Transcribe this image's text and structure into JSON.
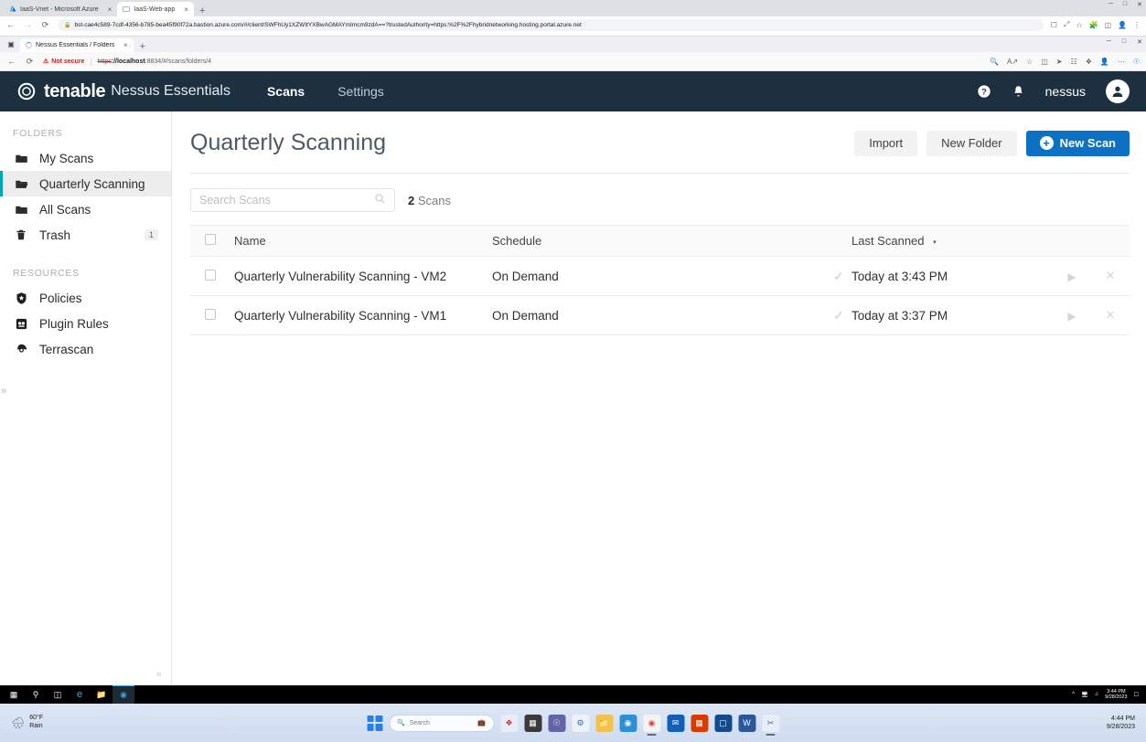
{
  "outer_browser": {
    "tabs": [
      {
        "title": "IaaS-Vnet - Microsoft Azure",
        "favicon": "azure-icon",
        "active": false
      },
      {
        "title": "IaaS-Web-app",
        "favicon": "page-icon",
        "active": true
      }
    ],
    "new_tab_label": "+",
    "close_label": "×",
    "window_controls": {
      "minimize": "─",
      "maximize": "□",
      "close": "✕"
    },
    "nav": {
      "back": "←",
      "forward": "→",
      "reload": "⟳"
    },
    "address": "bst-cae4c589-7cdf-4356-b785-bea45f90f72a.bastion.azure.com/#/client/SWFhUy1XZWItYXBwAGMAYmImcm9zdA==?trustedAuthority=https:%2F%2Fhybridnetworking.hosting.portal.azure.net",
    "lock_icon": "lock-icon",
    "toolbar_icons": [
      "cast-icon",
      "share-icon",
      "bookmark-star-icon",
      "extensions-puzzle-icon",
      "sidepanel-icon",
      "profile-avatar-icon",
      "more-kebab-icon"
    ]
  },
  "inner_browser": {
    "system_icon": "app-window-icon",
    "tab": {
      "title": "Nessus Essentials / Folders / Cus",
      "loading": true,
      "close_label": "×"
    },
    "new_tab_label": "+",
    "window_controls": {
      "minimize": "─",
      "maximize": "□",
      "close": "✕"
    },
    "nav": {
      "back": "←",
      "reload": "⟳"
    },
    "security_label": "Not secure",
    "url_scheme": "https",
    "url_host": "://localhost",
    "url_path": ":8834/#/scans/folders/4",
    "toolbar_icons": [
      "zoom-icon",
      "read-aloud-icon",
      "favorite-star-icon",
      "split-screen-icon",
      "collections-icon",
      "browser-essentials-icon",
      "copilot-icon",
      "profile-icon",
      "settings-more-icon",
      "bing-icon"
    ]
  },
  "app": {
    "brand": {
      "logo": "tenable-logo-icon",
      "name": "tenable",
      "product": "Nessus Essentials"
    },
    "nav_links": [
      {
        "label": "Scans",
        "active": true
      },
      {
        "label": "Settings",
        "active": false
      }
    ],
    "nav_right": {
      "help_icon": "help-question-icon",
      "notifications_icon": "bell-icon",
      "username": "nessus",
      "avatar_icon": "user-avatar-icon"
    },
    "sidebar": {
      "folders_heading": "FOLDERS",
      "folders": [
        {
          "label": "My Scans",
          "icon": "folder-icon",
          "active": false,
          "badge": ""
        },
        {
          "label": "Quarterly Scanning",
          "icon": "folder-open-icon",
          "active": true,
          "badge": ""
        },
        {
          "label": "All Scans",
          "icon": "folder-icon",
          "active": false,
          "badge": ""
        },
        {
          "label": "Trash",
          "icon": "trash-icon",
          "active": false,
          "badge": "1"
        }
      ],
      "resources_heading": "RESOURCES",
      "resources": [
        {
          "label": "Policies",
          "icon": "shield-star-icon"
        },
        {
          "label": "Plugin Rules",
          "icon": "plugin-icon"
        },
        {
          "label": "Terrascan",
          "icon": "terrascan-icon"
        }
      ],
      "collapse_icon": "«",
      "expand_icon": "»",
      "accent_color": "#00a5b5"
    },
    "page": {
      "title": "Quarterly Scanning",
      "buttons": {
        "import": "Import",
        "new_folder": "New Folder",
        "new_scan": "New Scan",
        "new_scan_plus_icon": "plus-circle-icon",
        "primary_color": "#0c71c3"
      },
      "search": {
        "placeholder": "Search Scans",
        "value": "",
        "icon": "search-icon"
      },
      "count_number": "2",
      "count_label": "Scans",
      "table": {
        "columns": [
          "",
          "Name",
          "Schedule",
          "",
          "Last Scanned",
          "",
          ""
        ],
        "header_name": "Name",
        "header_schedule": "Schedule",
        "header_last_scanned": "Last Scanned",
        "sort_icon": "▾",
        "select_all_checkbox": "checkbox-icon",
        "rows": [
          {
            "checkbox": "checkbox-icon",
            "name": "Quarterly Vulnerability Scanning - VM2",
            "schedule": "On Demand",
            "status_icon": "check-icon",
            "last_scanned": "Today at 3:43 PM",
            "launch_icon": "play-icon",
            "delete_icon": "close-x-icon"
          },
          {
            "checkbox": "checkbox-icon",
            "name": "Quarterly Vulnerability Scanning - VM1",
            "schedule": "On Demand",
            "status_icon": "check-icon",
            "last_scanned": "Today at 3:37 PM",
            "launch_icon": "play-icon",
            "delete_icon": "close-x-icon"
          }
        ]
      }
    }
  },
  "inner_taskbar": {
    "icons": [
      "windows-start-icon",
      "search-icon",
      "task-view-icon",
      "internet-explorer-icon",
      "file-explorer-icon",
      "microsoft-edge-icon"
    ],
    "tray_icons": [
      "show-hidden-icon",
      "network-icon",
      "volume-icon"
    ],
    "time": "3:44 PM",
    "date": "9/28/2023",
    "action_center_icon": "action-center-icon"
  },
  "outer_taskbar": {
    "weather_temp": "60°F",
    "weather_cond": "Rain",
    "weather_icon": "rain-cloud-icon",
    "start_icon": "windows-start-icon",
    "search_placeholder": "Search",
    "search_icon": "search-icon",
    "apps": [
      "briefcase-icon",
      "copilot-icon",
      "file-explorer-icon",
      "teams-icon",
      "settings-icon",
      "folder-icon",
      "edge-icon",
      "chrome-icon",
      "outlook-icon",
      "office-icon",
      "store-icon",
      "word-icon",
      "snip-icon"
    ],
    "time": "4:44 PM",
    "date": "9/28/2023"
  }
}
